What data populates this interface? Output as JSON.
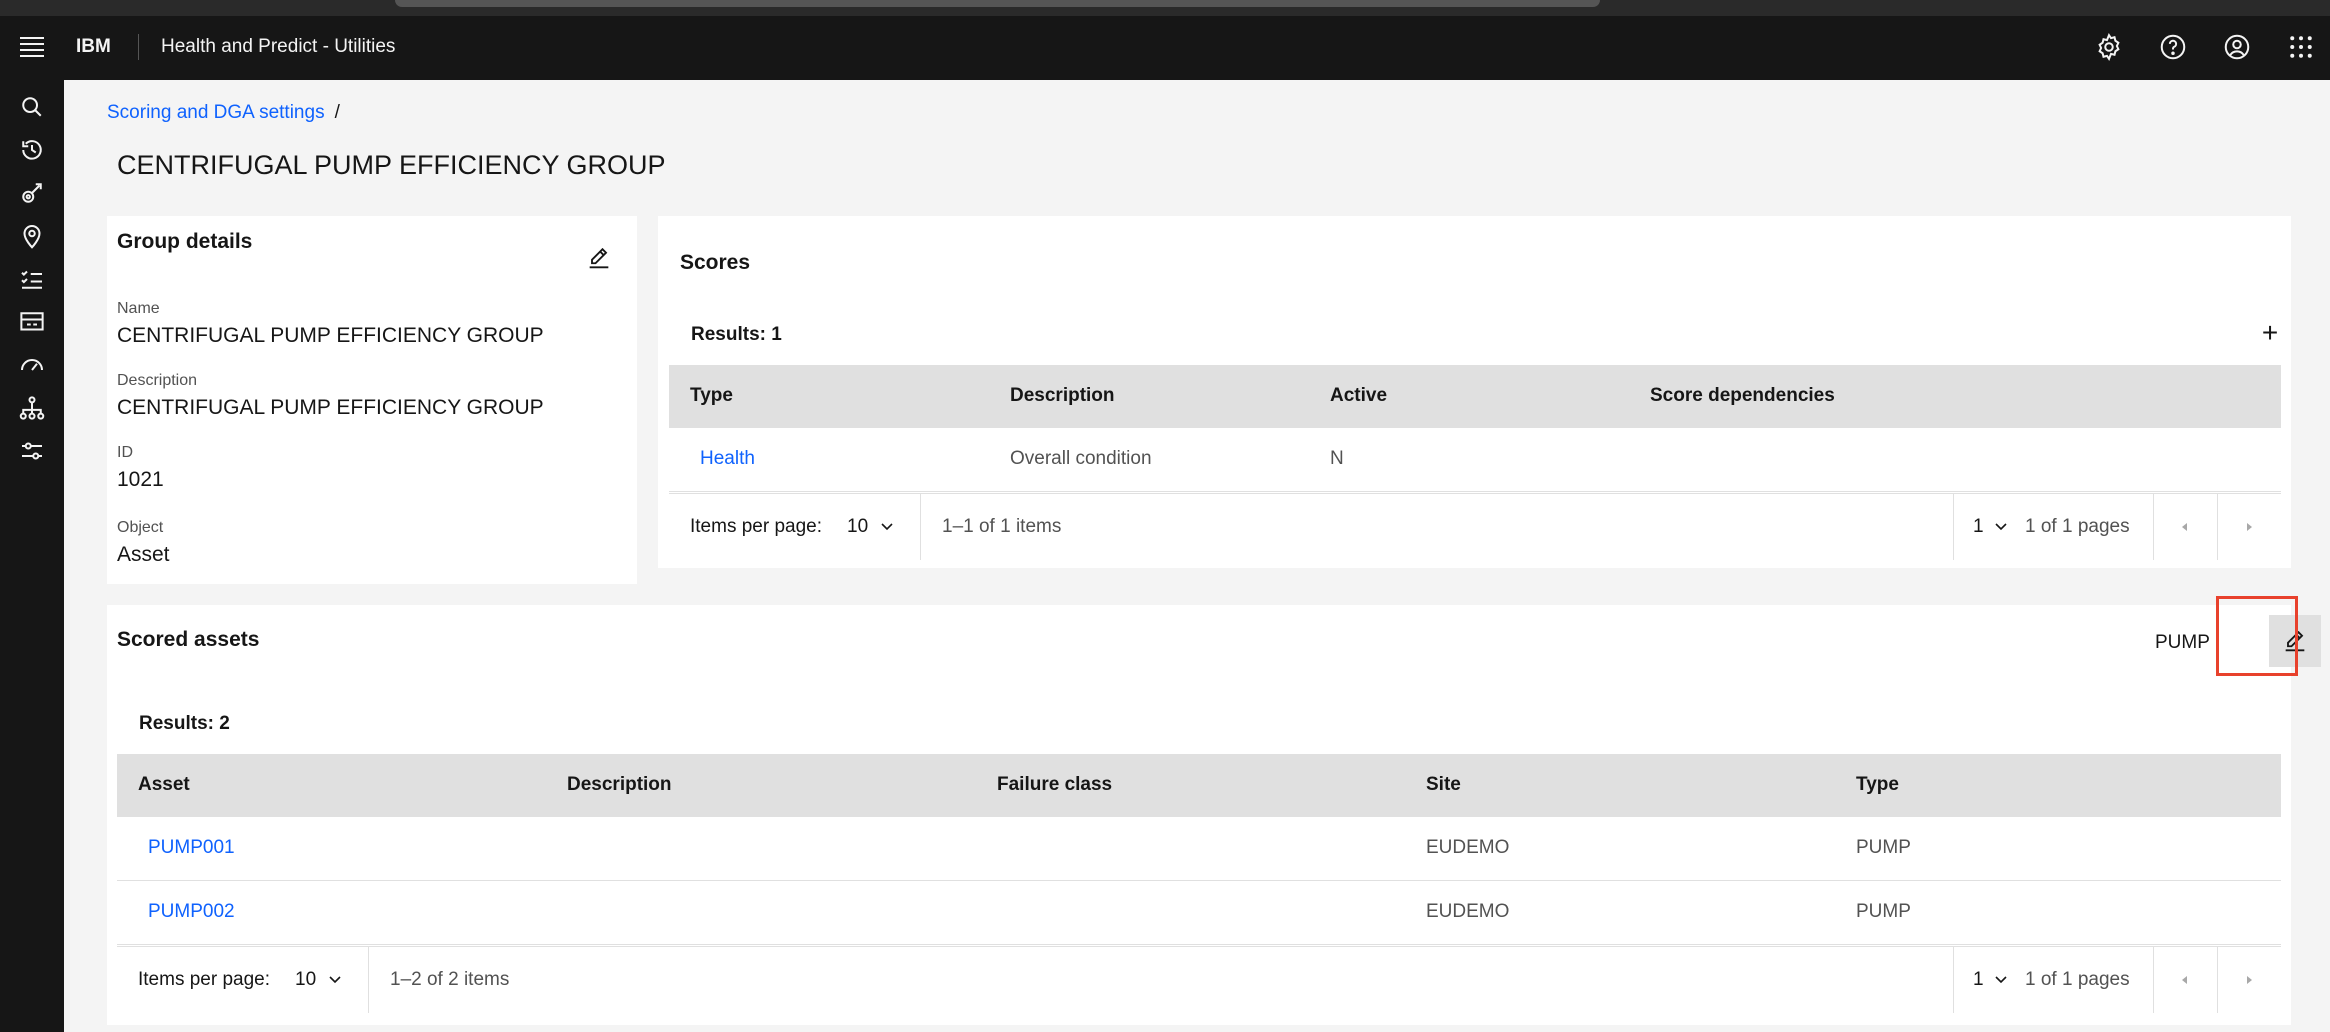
{
  "header": {
    "brand": "IBM",
    "product": "Health and Predict - Utilities"
  },
  "icons": {
    "menu": "hamburger-menu-icon",
    "settings": "gear-icon",
    "help": "help-icon",
    "user": "user-avatar-icon",
    "switcher": "app-switcher-icon"
  },
  "breadcrumb": {
    "parent": "Scoring and DGA settings",
    "separator": "/"
  },
  "page": {
    "title": "CENTRIFUGAL PUMP EFFICIENCY GROUP"
  },
  "group_details": {
    "title": "Group details",
    "fields": [
      {
        "label": "Name",
        "value": "CENTRIFUGAL PUMP EFFICIENCY GROUP"
      },
      {
        "label": "Description",
        "value": "CENTRIFUGAL PUMP EFFICIENCY GROUP"
      },
      {
        "label": "ID",
        "value": "1021"
      },
      {
        "label": "Object",
        "value": "Asset"
      }
    ]
  },
  "scores": {
    "title": "Scores",
    "results": "Results: 1",
    "add_label": "+",
    "columns": [
      "Type",
      "Description",
      "Active",
      "Score dependencies"
    ],
    "rows": [
      {
        "type": "Health",
        "description": "Overall condition",
        "active": "N",
        "dependencies": ""
      }
    ],
    "pager": {
      "items_per_page_label": "Items per page:",
      "items_per_page": "10",
      "range": "1–1 of 1 items",
      "page": "1",
      "total_pages": "1 of 1 pages"
    }
  },
  "scored_assets": {
    "title": "Scored assets",
    "asset_type": "PUMP",
    "results": "Results: 2",
    "columns": [
      "Asset",
      "Description",
      "Failure class",
      "Site",
      "Type"
    ],
    "rows": [
      {
        "asset": "PUMP001",
        "description": "",
        "failure_class": "",
        "site": "EUDEMO",
        "type": "PUMP"
      },
      {
        "asset": "PUMP002",
        "description": "",
        "failure_class": "",
        "site": "EUDEMO",
        "type": "PUMP"
      }
    ],
    "pager": {
      "items_per_page_label": "Items per page:",
      "items_per_page": "10",
      "range": "1–2 of 2 items",
      "page": "1",
      "total_pages": "1 of 1 pages"
    }
  },
  "colors": {
    "header_bg": "#161616",
    "link": "#0f62fe",
    "highlight": "#e8412c",
    "table_header": "#e0e0e0",
    "page_bg": "#f4f4f4"
  }
}
